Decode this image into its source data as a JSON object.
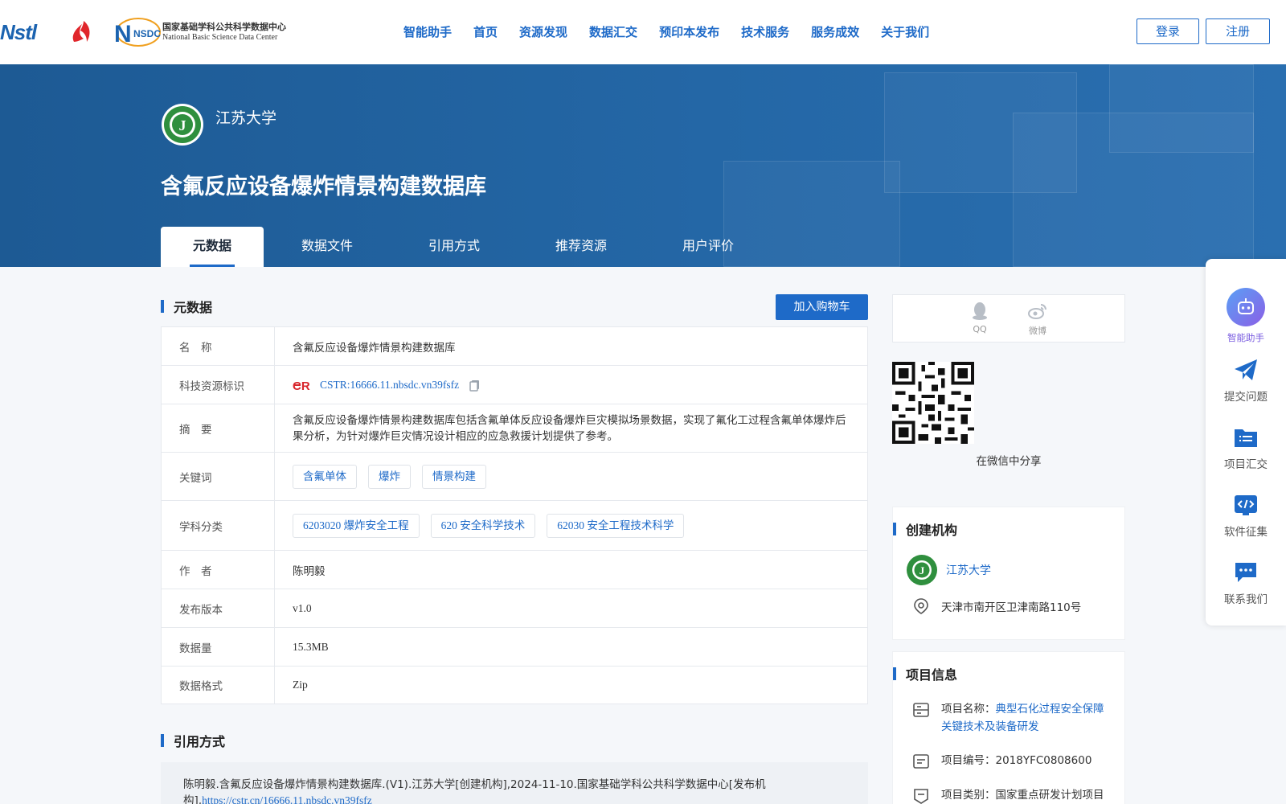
{
  "header": {
    "logos": {
      "nstl": "Nstl",
      "nsdc_mark": "NSDC",
      "nsdc_cn": "国家基础学科公共科学数据中心",
      "nsdc_en": "National Basic Science Data Center"
    },
    "nav": [
      "智能助手",
      "首页",
      "资源发现",
      "数据汇交",
      "预印本发布",
      "技术服务",
      "服务成效",
      "关于我们"
    ],
    "login": "登录",
    "register": "注册"
  },
  "banner": {
    "institution": "江苏大学",
    "title": "含氟反应设备爆炸情景构建数据库",
    "tabs": [
      "元数据",
      "数据文件",
      "引用方式",
      "推荐资源",
      "用户评价"
    ],
    "active_tab": 0
  },
  "metadata": {
    "section_title": "元数据",
    "cart_button": "加入购物车",
    "rows": {
      "name": {
        "key": "名　称",
        "value": "含氟反应设备爆炸情景构建数据库"
      },
      "cstr": {
        "key": "科技资源标识",
        "value": "CSTR:16666.11.nbsdc.vn39fsfz"
      },
      "abstract": {
        "key": "摘　要",
        "value": "含氟反应设备爆炸情景构建数据库包括含氟单体反应设备爆炸巨灾模拟场景数据，实现了氟化工过程含氟单体爆炸后果分析，为针对爆炸巨灾情况设计相应的应急救援计划提供了参考。"
      },
      "keywords": {
        "key": "关键词",
        "values": [
          "含氟单体",
          "爆炸",
          "情景构建"
        ]
      },
      "subjects": {
        "key": "学科分类",
        "values": [
          "6203020 爆炸安全工程",
          "620 安全科学技术",
          "62030 安全工程技术科学"
        ]
      },
      "author": {
        "key": "作　者",
        "value": "陈明毅"
      },
      "version": {
        "key": "发布版本",
        "value": "v1.0"
      },
      "size": {
        "key": "数据量",
        "value": "15.3MB"
      },
      "format": {
        "key": "数据格式",
        "value": "Zip"
      }
    }
  },
  "citation": {
    "section_title": "引用方式",
    "text": "陈明毅.含氟反应设备爆炸情景构建数据库.(V1).江苏大学[创建机构],2024-11-10.国家基础学科公共科学数据中心[发布机构],",
    "link": "https://cstr.cn/16666.11.nbsdc.vn39fsfz"
  },
  "share": {
    "qq": "QQ",
    "weibo": "微博",
    "wechat_caption": "在微信中分享"
  },
  "creator": {
    "section_title": "创建机构",
    "name": "江苏大学",
    "address": "天津市南开区卫津南路110号"
  },
  "project": {
    "section_title": "项目信息",
    "name_label": "项目名称：",
    "name_value": "典型石化过程安全保障关键技术及装备研发",
    "number": "项目编号：2018YFC0808600",
    "category": "项目类别：国家重点研发计划项目"
  },
  "float_panel": [
    "智能助手",
    "提交问题",
    "项目汇交",
    "软件征集",
    "联系我们"
  ],
  "colors": {
    "primary": "#1e6ac8",
    "banner": "#1f5f9d",
    "ai": "#7a5ce0"
  }
}
